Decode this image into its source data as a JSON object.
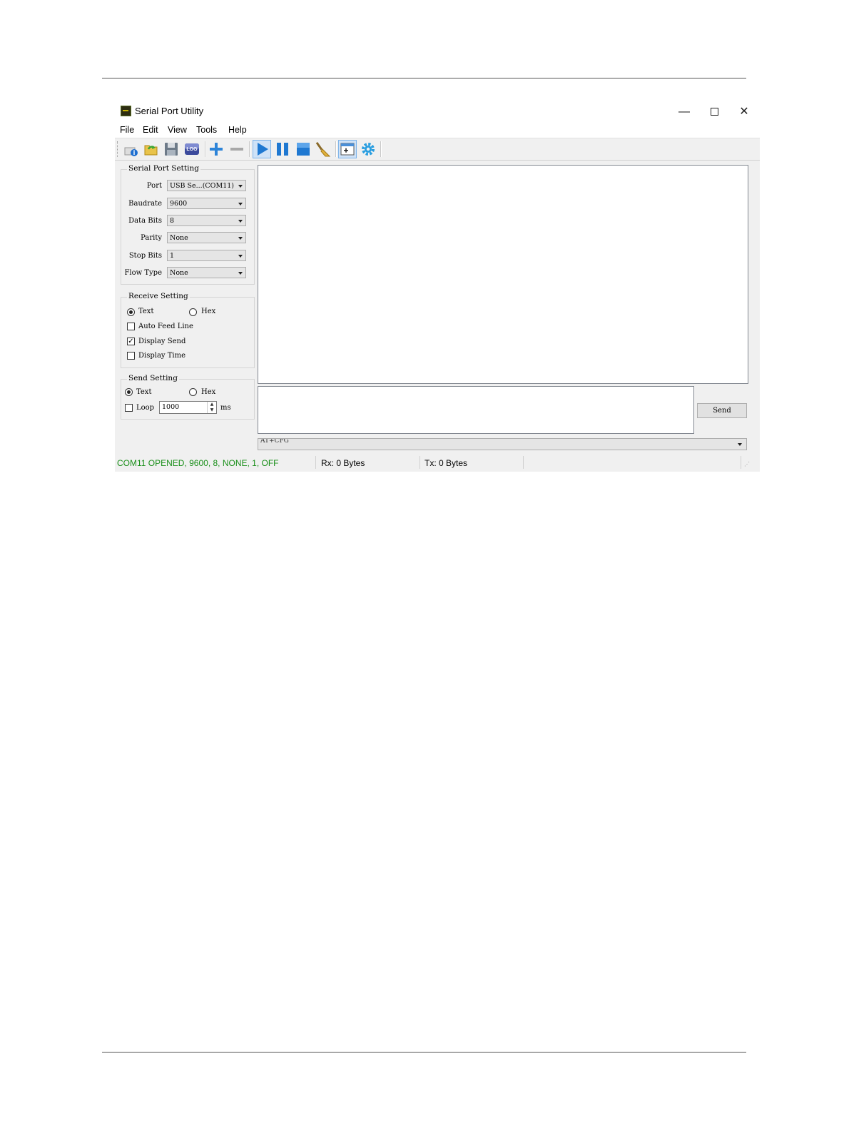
{
  "window": {
    "title": "Serial Port Utility"
  },
  "menu": [
    "File",
    "Edit",
    "View",
    "Tools",
    "Help"
  ],
  "toolbar": {
    "log_label": "LOG"
  },
  "serial_port_setting": {
    "title": "Serial Port Setting",
    "fields": [
      {
        "label": "Port",
        "value": "USB Se...(COM11)"
      },
      {
        "label": "Baudrate",
        "value": "9600"
      },
      {
        "label": "Data Bits",
        "value": "8"
      },
      {
        "label": "Parity",
        "value": "None"
      },
      {
        "label": "Stop Bits",
        "value": "1"
      },
      {
        "label": "Flow Type",
        "value": "None"
      }
    ]
  },
  "receive_setting": {
    "title": "Receive Setting",
    "text_label": "Text",
    "hex_label": "Hex",
    "mode": "Text",
    "auto_feed_line": {
      "label": "Auto Feed Line",
      "checked": false
    },
    "display_send": {
      "label": "Display Send",
      "checked": true
    },
    "display_time": {
      "label": "Display Time",
      "checked": false
    }
  },
  "send_setting": {
    "title": "Send Setting",
    "text_label": "Text",
    "hex_label": "Hex",
    "mode": "Text",
    "loop_label": "Loop",
    "loop_checked": false,
    "loop_value": "1000",
    "unit": "ms"
  },
  "send_button": "Send",
  "command_combo_value": "AT+CFG",
  "status": {
    "connection": "COM11 OPENED, 9600, 8, NONE, 1, OFF",
    "rx": "Rx: 0 Bytes",
    "tx": "Tx: 0 Bytes",
    "connection_color": "#1a8f1a"
  },
  "icons": [
    "new-file-icon",
    "open-folder-icon",
    "save-icon",
    "log-icon",
    "add-icon",
    "remove-icon",
    "play-icon",
    "pause-icon",
    "stop-icon",
    "clear-broom-icon",
    "window-add-icon",
    "settings-gear-icon"
  ]
}
